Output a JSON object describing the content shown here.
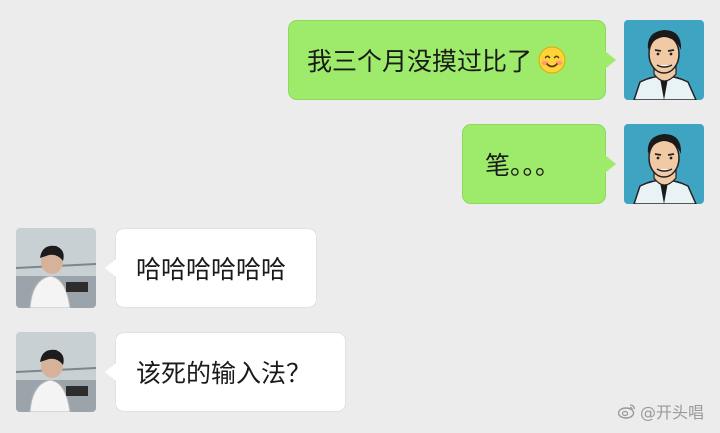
{
  "messages": [
    {
      "side": "out",
      "text": "我三个月没摸过比了",
      "emoji": "smiling-blush"
    },
    {
      "side": "out",
      "text": "笔。。。"
    },
    {
      "side": "in",
      "text": "哈哈哈哈哈哈"
    },
    {
      "side": "in",
      "text": "该死的输入法？"
    }
  ],
  "watermark": {
    "text": "@开头唱",
    "icon": "weibo-icon"
  },
  "colors": {
    "background": "#ececec",
    "outgoing_bubble": "#9eea6a",
    "incoming_bubble": "#ffffff"
  }
}
